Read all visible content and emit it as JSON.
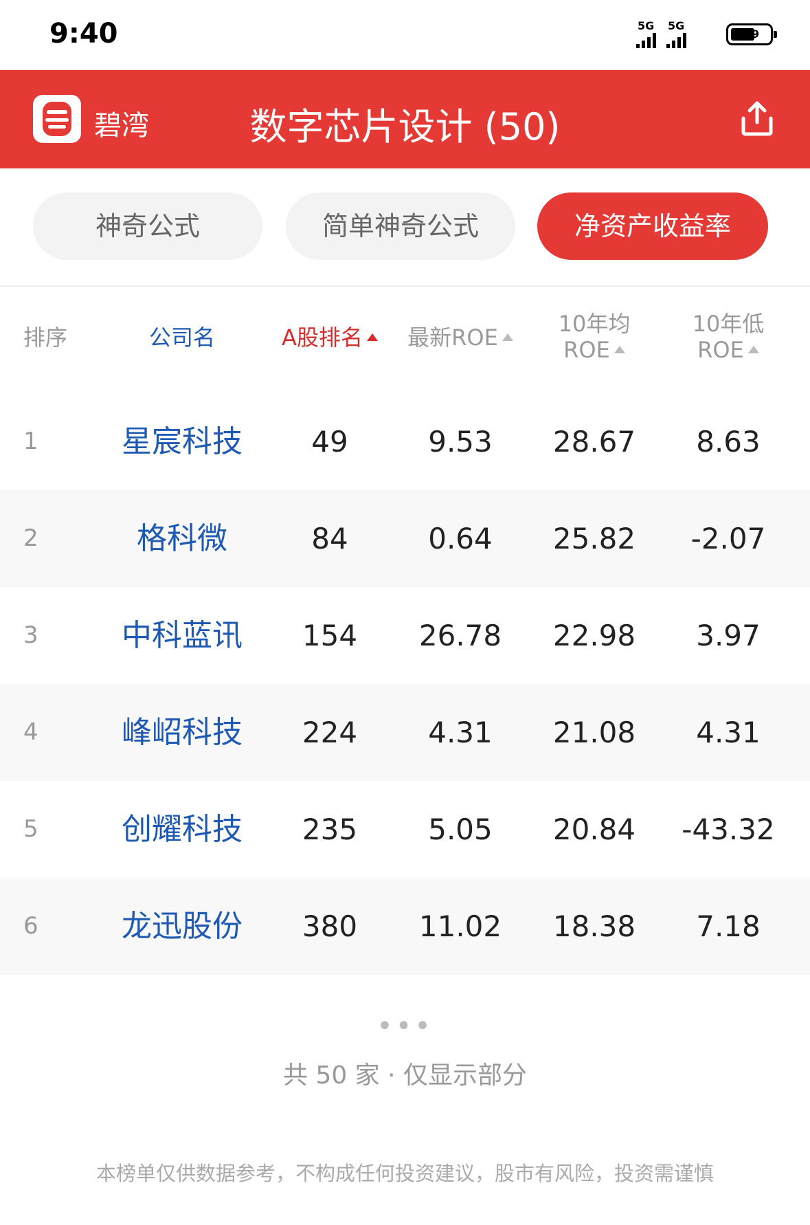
{
  "status_bar": {
    "time": "9:40",
    "network_1": "5G",
    "network_2": "5G",
    "battery_level": "9"
  },
  "app_bar": {
    "brand": "碧湾",
    "title": "数字芯片设计 (50)",
    "logo_icon": "bw-logo-icon",
    "share_icon": "share-icon",
    "accent_color": "#e53935"
  },
  "tabs": [
    {
      "label": "神奇公式",
      "active": false
    },
    {
      "label": "简单神奇公式",
      "active": false
    },
    {
      "label": "净资产收益率",
      "active": true
    }
  ],
  "table": {
    "headers": {
      "rank": "排序",
      "name": "公司名",
      "a_rank": "A股排名",
      "latest_roe": "最新ROE",
      "avg10_line1": "10年均",
      "avg10_line2": "ROE",
      "low10_line1": "10年低",
      "low10_line2": "ROE"
    },
    "rows": [
      {
        "rank": "1",
        "name": "星宸科技",
        "a_rank": "49",
        "latest_roe": "9.53",
        "avg10": "28.67",
        "low10": "8.63"
      },
      {
        "rank": "2",
        "name": "格科微",
        "a_rank": "84",
        "latest_roe": "0.64",
        "avg10": "25.82",
        "low10": "-2.07"
      },
      {
        "rank": "3",
        "name": "中科蓝讯",
        "a_rank": "154",
        "latest_roe": "26.78",
        "avg10": "22.98",
        "low10": "3.97"
      },
      {
        "rank": "4",
        "name": "峰岹科技",
        "a_rank": "224",
        "latest_roe": "4.31",
        "avg10": "21.08",
        "low10": "4.31"
      },
      {
        "rank": "5",
        "name": "创耀科技",
        "a_rank": "235",
        "latest_roe": "5.05",
        "avg10": "20.84",
        "low10": "-43.32"
      },
      {
        "rank": "6",
        "name": "龙迅股份",
        "a_rank": "380",
        "latest_roe": "11.02",
        "avg10": "18.38",
        "low10": "7.18"
      }
    ]
  },
  "more_indicator": "•••",
  "footer": {
    "count_text": "共 50 家 · 仅显示部分",
    "disclaimer": "本榜单仅供数据参考，不构成任何投资建议，股市有风险，投资需谨慎"
  }
}
